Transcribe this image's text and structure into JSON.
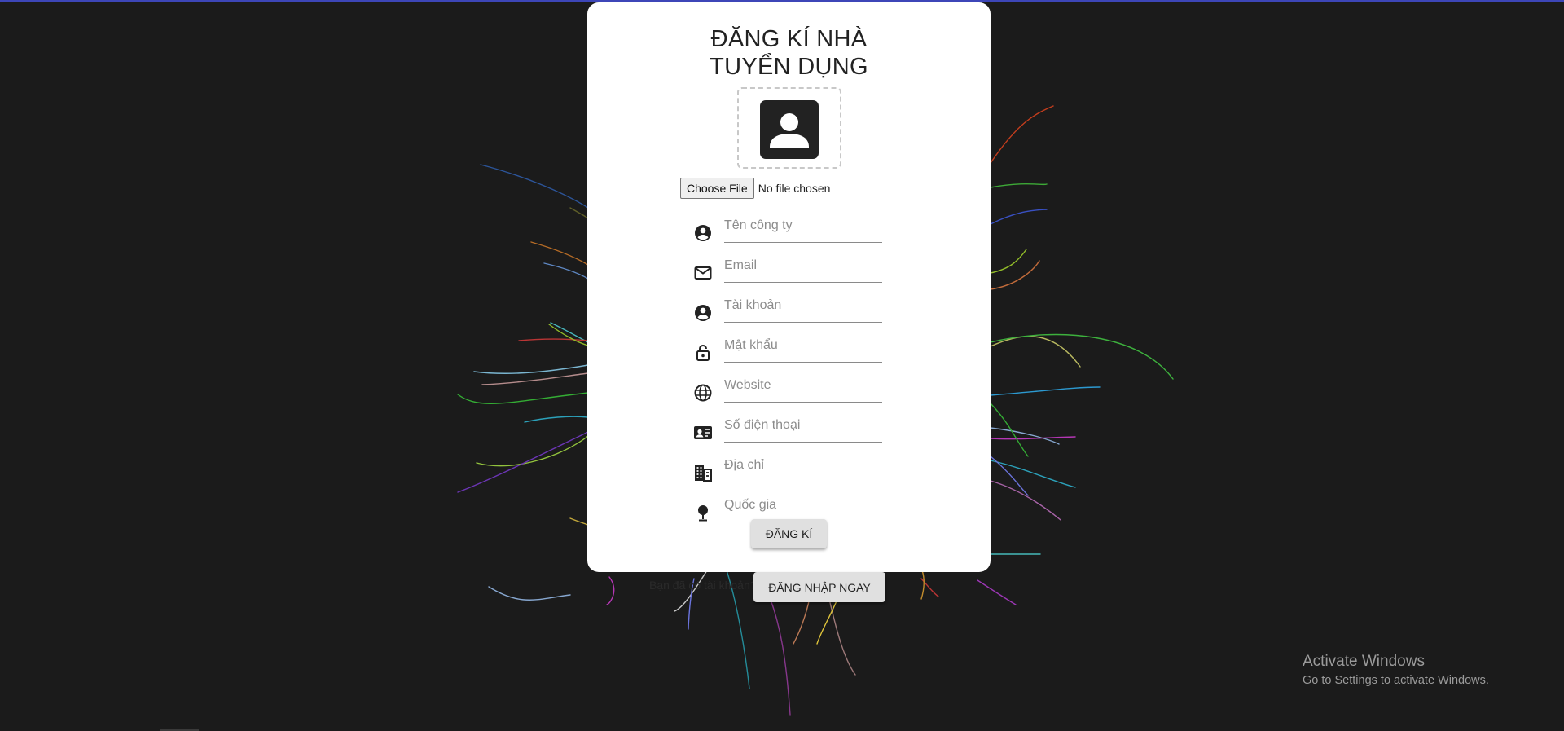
{
  "form": {
    "title_line1": "ĐĂNG KÍ NHÀ",
    "title_line2": "TUYỂN DỤNG",
    "avatar_icon": "account-avatar-icon",
    "file_button_label": "Choose File",
    "file_status": "No file chosen",
    "fields": [
      {
        "icon": "account-circle-icon",
        "placeholder": "Tên công ty",
        "value": ""
      },
      {
        "icon": "mail-icon",
        "placeholder": "Email",
        "value": ""
      },
      {
        "icon": "account-circle-icon",
        "placeholder": "Tài khoản",
        "value": ""
      },
      {
        "icon": "lock-icon",
        "placeholder": "Mật khẩu",
        "value": ""
      },
      {
        "icon": "globe-icon",
        "placeholder": "Website",
        "value": ""
      },
      {
        "icon": "contact-card-icon",
        "placeholder": "Số điện thoại",
        "value": ""
      },
      {
        "icon": "building-icon",
        "placeholder": "Địa chỉ",
        "value": ""
      },
      {
        "icon": "location-pin-icon",
        "placeholder": "Quốc gia",
        "value": ""
      }
    ],
    "register_label": "ĐĂNG KÍ"
  },
  "footer": {
    "have_account_text": "Bạn đã có tài khoản?",
    "login_label": "ĐĂNG NHẬP NGAY"
  },
  "watermark": {
    "title": "Activate Windows",
    "subtitle": "Go to Settings to activate Windows."
  },
  "colors": {
    "background": "#1b1b1b",
    "card": "#ffffff",
    "button": "#e0e0e0",
    "top_line": "#3d46b8"
  }
}
